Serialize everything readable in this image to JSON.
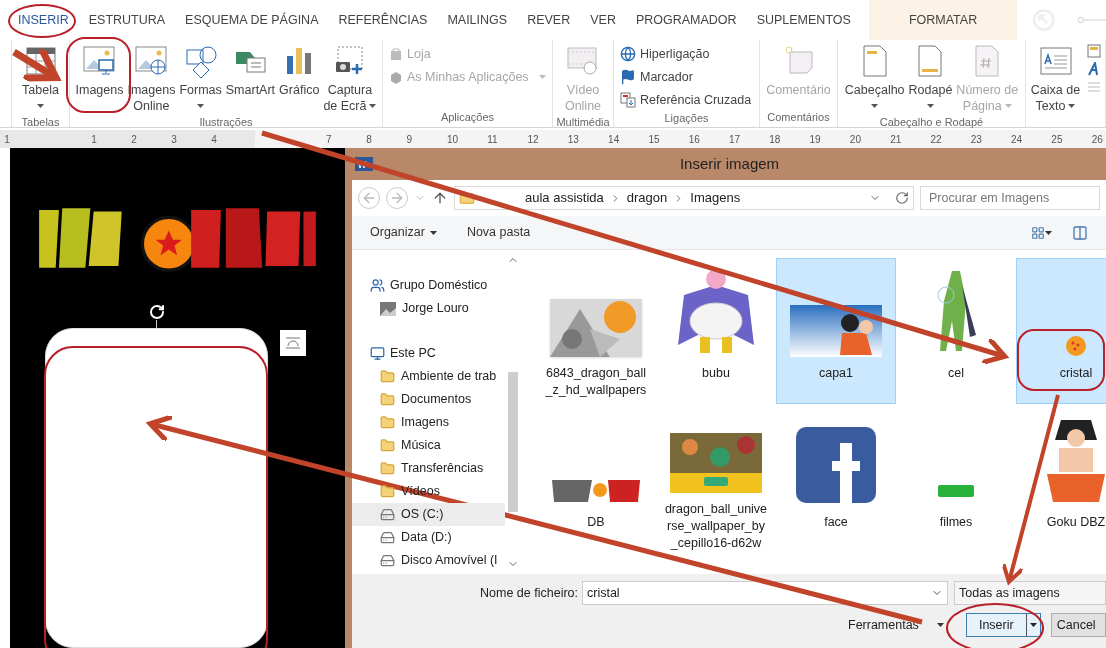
{
  "tabs": [
    {
      "label": "INSERIR",
      "selected": true,
      "contextual": false
    },
    {
      "label": "ESTRUTURA",
      "selected": false,
      "contextual": false
    },
    {
      "label": "ESQUEMA DE PÁGINA",
      "selected": false,
      "contextual": false
    },
    {
      "label": "REFERÊNCIAS",
      "selected": false,
      "contextual": false
    },
    {
      "label": "MAILINGS",
      "selected": false,
      "contextual": false
    },
    {
      "label": "REVER",
      "selected": false,
      "contextual": false
    },
    {
      "label": "VER",
      "selected": false,
      "contextual": false
    },
    {
      "label": "PROGRAMADOR",
      "selected": false,
      "contextual": false
    },
    {
      "label": "SUPLEMENTOS",
      "selected": false,
      "contextual": false
    },
    {
      "label": "FORMATAR",
      "selected": false,
      "contextual": true
    }
  ],
  "ribbon": [
    {
      "label": "Tabelas",
      "buttons": [
        {
          "kind": "large",
          "lines": [
            "Tabela"
          ],
          "dropdown": true,
          "disabled": false
        }
      ]
    },
    {
      "label": "Ilustrações",
      "buttons": [
        {
          "kind": "large",
          "lines": [
            "Imagens"
          ],
          "dropdown": false,
          "disabled": false
        },
        {
          "kind": "large",
          "lines": [
            "Imagens",
            "Online"
          ],
          "dropdown": false,
          "disabled": false
        },
        {
          "kind": "large",
          "lines": [
            "Formas"
          ],
          "dropdown": true,
          "disabled": false
        },
        {
          "kind": "large",
          "lines": [
            "SmartArt"
          ],
          "dropdown": false,
          "disabled": false
        },
        {
          "kind": "large",
          "lines": [
            "Gráfico"
          ],
          "dropdown": false,
          "disabled": false
        },
        {
          "kind": "large",
          "lines": [
            "Captura",
            "de Ecrã"
          ],
          "dropdown": true,
          "disabled": false
        }
      ]
    },
    {
      "label": "Aplicações",
      "buttons": [
        {
          "kind": "small",
          "lines": [
            "Loja"
          ],
          "dropdown": false,
          "disabled": true
        },
        {
          "kind": "small",
          "lines": [
            "As Minhas Aplicações"
          ],
          "dropdown": true,
          "disabled": true
        }
      ]
    },
    {
      "label": "Multimédia",
      "buttons": [
        {
          "kind": "large",
          "lines": [
            "Vídeo",
            "Online"
          ],
          "dropdown": false,
          "disabled": true
        }
      ]
    },
    {
      "label": "Ligações",
      "buttons": [
        {
          "kind": "small",
          "lines": [
            "Hiperligação"
          ],
          "disabled": false
        },
        {
          "kind": "small",
          "lines": [
            "Marcador"
          ],
          "disabled": false
        },
        {
          "kind": "small",
          "lines": [
            "Referência Cruzada"
          ],
          "disabled": false
        }
      ]
    },
    {
      "label": "Comentários",
      "buttons": [
        {
          "kind": "large",
          "lines": [
            "Comentário"
          ],
          "dropdown": false,
          "disabled": true
        }
      ]
    },
    {
      "label": "Cabeçalho e Rodapé",
      "buttons": [
        {
          "kind": "large",
          "lines": [
            "Cabeçalho"
          ],
          "dropdown": true,
          "disabled": false
        },
        {
          "kind": "large",
          "lines": [
            "Rodapé"
          ],
          "dropdown": true,
          "disabled": false
        },
        {
          "kind": "large",
          "lines": [
            "Número de",
            "Página"
          ],
          "dropdown": true,
          "disabled": true
        }
      ]
    },
    {
      "buttons": [
        {
          "kind": "large",
          "lines": [
            "Caixa de",
            "Texto"
          ],
          "dropdown": true,
          "disabled": false
        }
      ]
    }
  ],
  "ruler": {
    "left_numbers": [
      "1",
      "1",
      "2",
      "3",
      "4"
    ],
    "right_numbers": [
      "7",
      "8",
      "9",
      "10",
      "11",
      "12",
      "13",
      "14",
      "15",
      "16",
      "17",
      "18",
      "19",
      "20",
      "21",
      "22",
      "23",
      "24",
      "25",
      "26"
    ]
  },
  "dialog": {
    "title": "Inserir imagem",
    "path": [
      "aula assistida",
      "dragon",
      "Imagens"
    ],
    "search": {
      "placeholder": "Procurar em Imagens"
    },
    "toolbar": {
      "organize": "Organizar",
      "new_folder": "Nova pasta"
    },
    "nav": [
      {
        "label": "Grupo Doméstico",
        "selected": false,
        "children": [
          {
            "label": "Jorge Louro",
            "selected": false
          }
        ]
      },
      {
        "label": "Este PC",
        "selected": false,
        "children": [
          {
            "label": "Ambiente de trab",
            "selected": false
          },
          {
            "label": "Documentos",
            "selected": false
          },
          {
            "label": "Imagens",
            "selected": false
          },
          {
            "label": "Música",
            "selected": false
          },
          {
            "label": "Transferências",
            "selected": false
          },
          {
            "label": "Vídeos",
            "selected": false
          },
          {
            "label": "OS (C:)",
            "selected": true
          },
          {
            "label": "Data (D:)",
            "selected": false
          },
          {
            "label": "Disco Amovível (I",
            "selected": false
          }
        ]
      }
    ],
    "files": [
      {
        "name": "6843_dragon_ball_z_hd_wallpapers",
        "selected": false
      },
      {
        "name": "bubu",
        "selected": false
      },
      {
        "name": "capa1",
        "selected": true
      },
      {
        "name": "cel",
        "selected": false
      },
      {
        "name": "cristal",
        "selected": true
      },
      {
        "name": "DB",
        "selected": false
      },
      {
        "name": "dragon_ball_universe_wallpaper_by_cepillo16-d62w",
        "selected": false
      },
      {
        "name": "face",
        "selected": false
      },
      {
        "name": "filmes",
        "selected": false
      },
      {
        "name": "Goku DBZ",
        "selected": false
      }
    ],
    "filename_label": "Nome de ficheiro:",
    "filename": "cristal",
    "filter": "Todas as imagens",
    "tools": "Ferramentas",
    "insert": "Inserir",
    "cancel": "Cancel"
  }
}
